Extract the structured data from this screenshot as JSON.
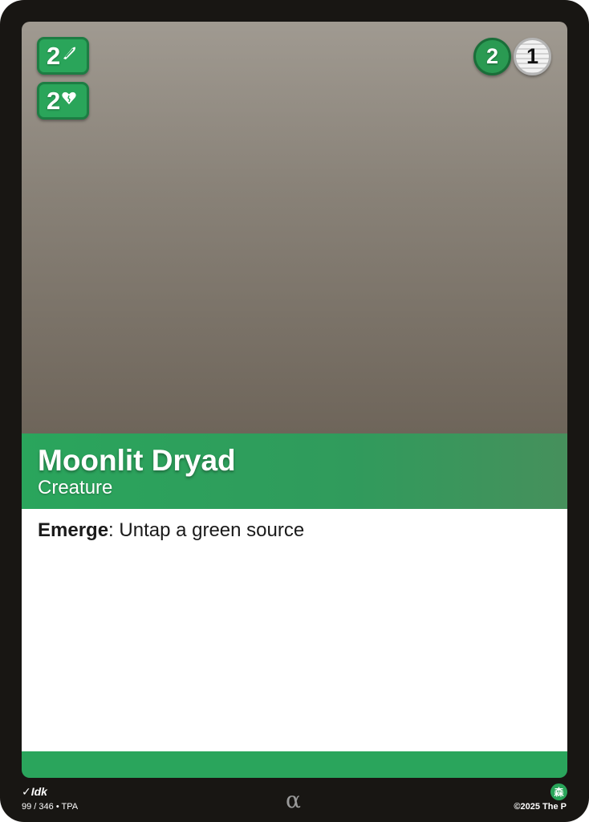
{
  "card": {
    "name": "Moonlit Dryad",
    "type": "Creature",
    "rules": {
      "keyword": "Emerge",
      "text": ": Untap a green source"
    },
    "stats": [
      {
        "value": "2",
        "icon": "sword-icon"
      },
      {
        "value": "2",
        "icon": "heart-icon"
      }
    ],
    "cost": [
      {
        "value": "2",
        "color": "#2a9a52"
      },
      {
        "value": "1",
        "color": "#e6e6e6"
      }
    ],
    "footer": {
      "artist": "Idk",
      "collector_number": "99 / 346 • TPA",
      "rarity_symbol": "α",
      "copyright": "©2025 The P",
      "set_icon_glyph": "森"
    },
    "colors": {
      "frame": "#181613",
      "accent_green": "#2aa55c"
    }
  }
}
